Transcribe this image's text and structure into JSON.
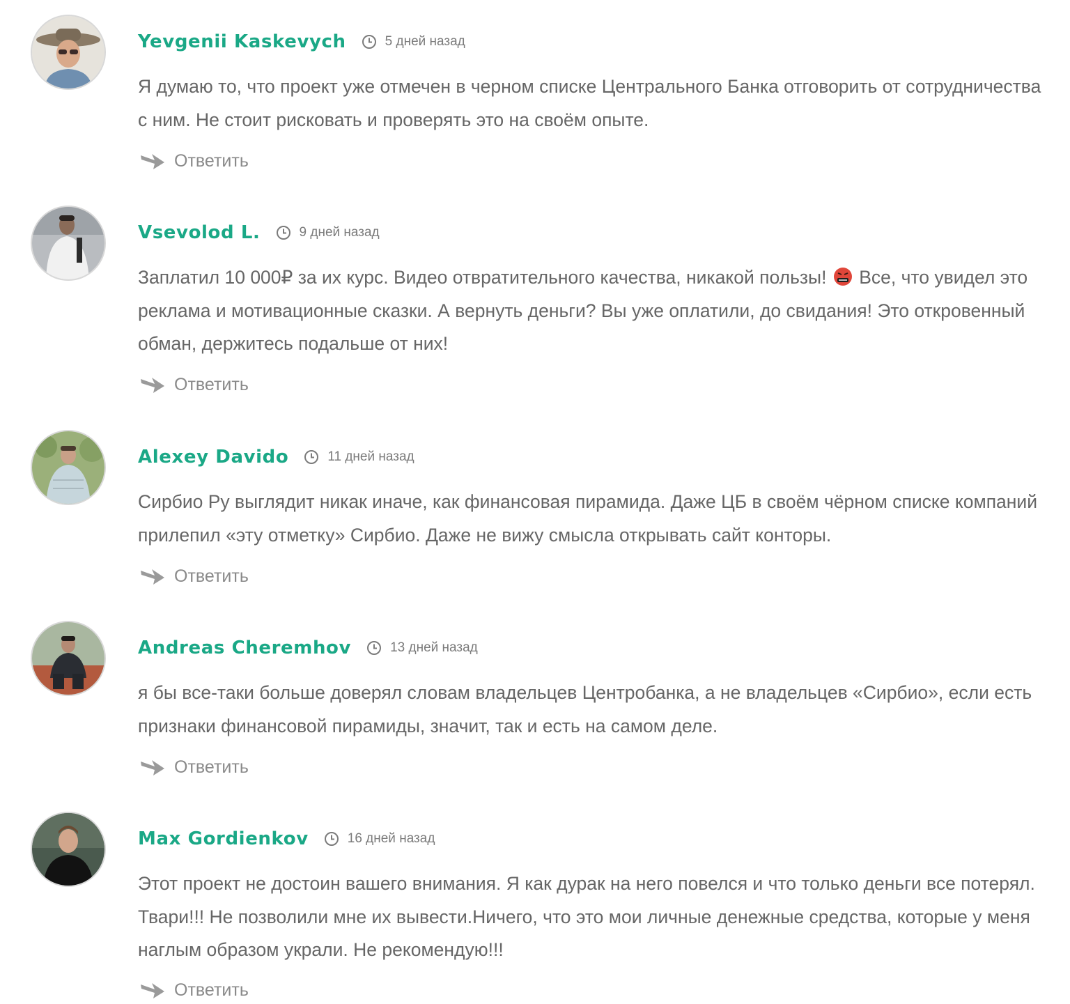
{
  "colors": {
    "author": "#1aa886",
    "text": "#666666",
    "meta": "#7b7b7b",
    "reply": "#8a8a8a",
    "avatar_border": "#d8d8d8"
  },
  "reply_label": "Ответить",
  "comments": [
    {
      "author": "Yevgenii Kaskevych",
      "time": "5 дней назад",
      "text": "Я думаю то, что проект уже отмечен в черном списке Центрального Банка отговорить от сотрудничества с ним. Не стоит рисковать и проверять это на своём опыте."
    },
    {
      "author": "Vsevolod L.",
      "time": "9 дней назад",
      "text_before": "Заплатил 10 000₽ за их курс. Видео отвратительного качества, никакой пользы!",
      "emoji": "angry-face-emoji",
      "text_after": "Все, что увидел это реклама и мотивационные сказки. А вернуть деньги? Вы уже оплатили, до свидания! Это откровенный обман, держитесь подальше от них!"
    },
    {
      "author": "Alexey Davido",
      "time": "11 дней назад",
      "text": "Сирбио Ру выглядит никак иначе, как финансовая пирамида. Даже ЦБ в своём чёрном списке компаний прилепил «эту отметку» Сирбио. Даже не вижу смысла открывать сайт конторы."
    },
    {
      "author": "Andreas Cheremhov",
      "time": "13 дней назад",
      "text": "я бы все-таки больше доверял словам владельцев Центробанка, а не владельцев «Сирбио», если есть признаки финансовой пирамиды, значит, так и есть на самом деле."
    },
    {
      "author": "Max Gordienkov",
      "time": "16 дней назад",
      "text": "Этот проект не достоин вашего внимания. Я как дурак на него повелся и что только деньги все потерял. Твари!!! Не позволили мне их вывести.Ничего, что это мои личные денежные средства, которые у меня наглым образом украли. Не рекомендую!!!"
    }
  ]
}
